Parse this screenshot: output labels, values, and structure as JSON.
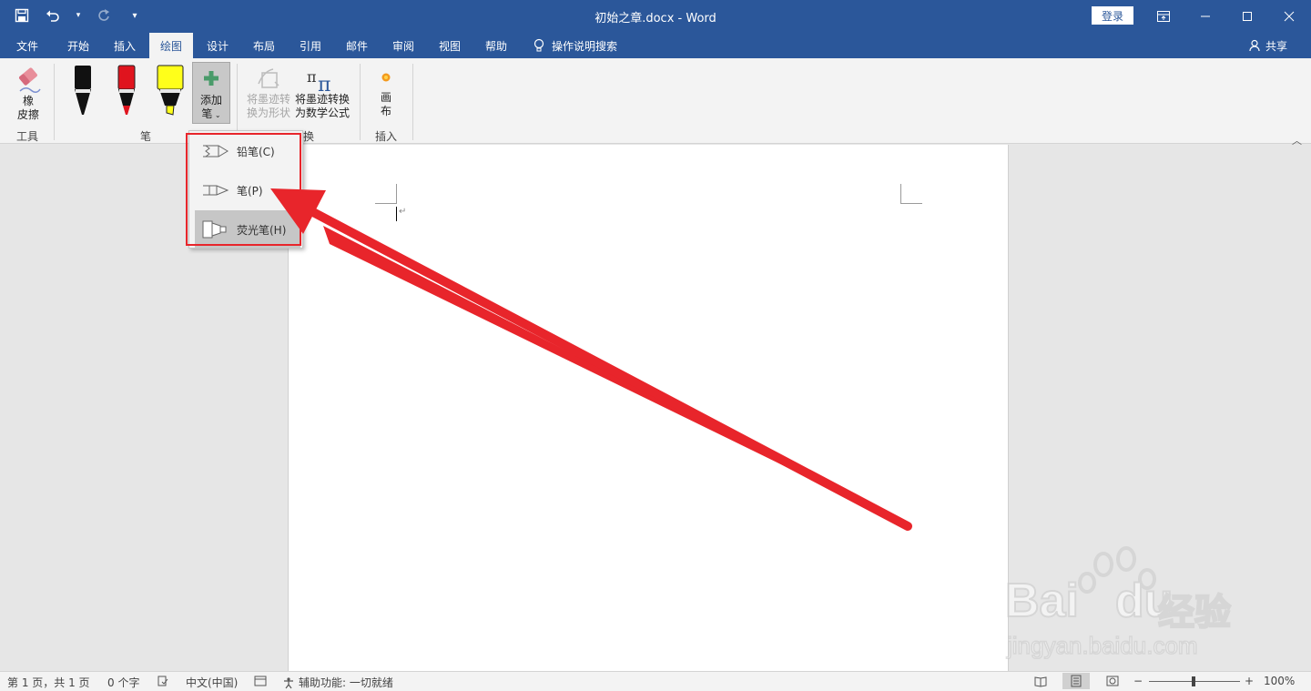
{
  "window": {
    "title": "初始之章.docx  -  Word",
    "login": "登录"
  },
  "tabs": [
    "文件",
    "开始",
    "插入",
    "绘图",
    "设计",
    "布局",
    "引用",
    "邮件",
    "审阅",
    "视图",
    "帮助"
  ],
  "active_tab": "绘图",
  "tell_me": "操作说明搜索",
  "share": "共享",
  "ribbon": {
    "eraser_l1": "橡",
    "eraser_l2": "皮擦",
    "tools_group": "工具",
    "add_pen_l1": "添加",
    "add_pen_l2": "笔",
    "pens_group": "笔",
    "ink_to_shape_l1": "将墨迹转",
    "ink_to_shape_l2": "换为形状",
    "ink_to_math_l1": "将墨迹转换",
    "ink_to_math_l2": "为数学公式",
    "convert_group_partial": "换",
    "canvas_l1": "画",
    "canvas_l2": "布",
    "insert_group": "插入"
  },
  "pen_colors": {
    "black": "#111111",
    "red": "#e0141e",
    "yellow": "#ffff1a"
  },
  "dropdown": {
    "pencil": "铅笔(C)",
    "pen": "笔(P)",
    "highlighter": "荧光笔(H)"
  },
  "status": {
    "pages": "第 1 页，共 1 页",
    "words": "0 个字",
    "language": "中文(中国)",
    "accessibility": "辅助功能: 一切就绪",
    "zoom": "100%"
  },
  "watermark": {
    "brand": "Bai",
    "brand2": "du",
    "jingyan": "经验",
    "url": "jingyan.baidu.com"
  },
  "colors": {
    "title_bar": "#2b579a",
    "ribbon_bg": "#f3f3f3",
    "annotation_red": "#e8252b"
  }
}
